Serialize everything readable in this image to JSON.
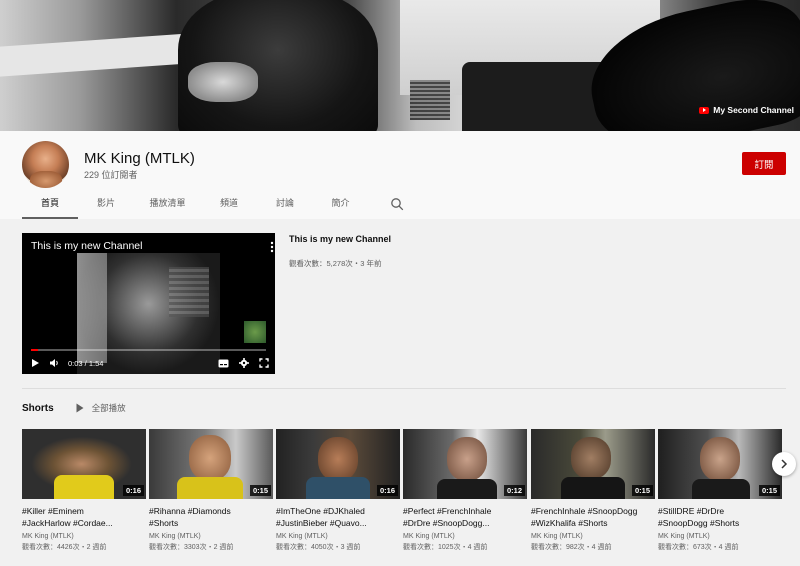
{
  "banner": {
    "link_label": "My Second Channel"
  },
  "channel": {
    "name": "MK King (MTLK)",
    "subscribers": "229 位訂閱者",
    "subscribe_label": "訂閱"
  },
  "tabs": [
    {
      "label": "首頁",
      "active": true
    },
    {
      "label": "影片"
    },
    {
      "label": "播放清單"
    },
    {
      "label": "頻道"
    },
    {
      "label": "討論"
    },
    {
      "label": "簡介"
    }
  ],
  "featured": {
    "player_title": "This is my new Channel",
    "current_time": "0:03",
    "duration": "1:54",
    "time_display": "0:03 / 1:54",
    "progress": 0.03,
    "title": "This is my new Channel",
    "info": "觀看次數：5,278次・3 年前"
  },
  "shorts": {
    "title": "Shorts",
    "play_all": "全部播放",
    "items": [
      {
        "title": "#Killer #Eminem\n#JackHarlow #Cordae...",
        "duration": "0:16",
        "channel": "MK King (MTLK)",
        "info": "觀看次數：4426次・2 週前"
      },
      {
        "title": "#Rihanna #Diamonds\n#Shorts",
        "duration": "0:15",
        "channel": "MK King (MTLK)",
        "info": "觀看次數：3303次・2 週前"
      },
      {
        "title": "#ImTheOne #DJKhaled\n#JustinBieber #Quavo...",
        "duration": "0:16",
        "channel": "MK King (MTLK)",
        "info": "觀看次數：4050次・3 週前"
      },
      {
        "title": "#Perfect #FrenchInhale\n#DrDre #SnoopDogg...",
        "duration": "0:12",
        "channel": "MK King (MTLK)",
        "info": "觀看次數：1025次・4 週前"
      },
      {
        "title": "#FrenchInhale #SnoopDogg\n#WizKhalifa #Shorts",
        "duration": "0:15",
        "channel": "MK King (MTLK)",
        "info": "觀看次數：982次・4 週前"
      },
      {
        "title": "#StillDRE #DrDre\n#SnoopDogg #Shorts",
        "duration": "0:15",
        "channel": "MK King (MTLK)",
        "info": "觀看次數：673次・4 週前"
      }
    ]
  },
  "colors": {
    "subscribe_bg": "#cc0000",
    "progress": "#ff0000",
    "accent": "#ff0000"
  }
}
